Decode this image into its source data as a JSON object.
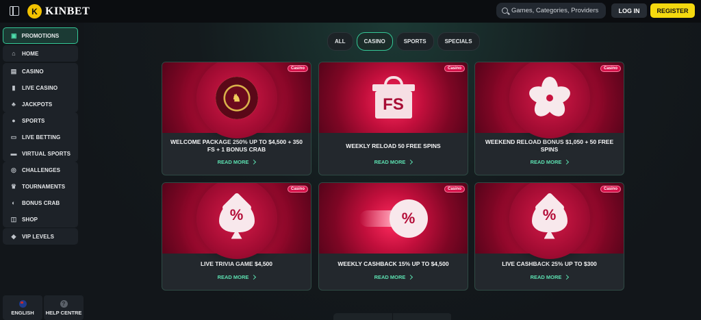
{
  "header": {
    "logo_text": "KINBET",
    "search_placeholder": "Games, Categories, Providers",
    "login_label": "LOG IN",
    "register_label": "REGISTER",
    "register_color": "#f4d90f"
  },
  "sidebar": {
    "active": {
      "label": "PROMOTIONS",
      "icon": "gift-icon"
    },
    "groups": [
      [
        {
          "label": "HOME",
          "icon": "home-icon"
        }
      ],
      [
        {
          "label": "CASINO",
          "icon": "slot-machine-icon"
        },
        {
          "label": "LIVE CASINO",
          "icon": "card-icon"
        },
        {
          "label": "JACKPOTS",
          "icon": "clover-icon"
        }
      ],
      [
        {
          "label": "SPORTS",
          "icon": "ball-icon"
        },
        {
          "label": "LIVE BETTING",
          "icon": "live-icon"
        },
        {
          "label": "VIRTUAL SPORTS",
          "icon": "virtual-icon"
        }
      ],
      [
        {
          "label": "CHALLENGES",
          "icon": "medal-icon"
        },
        {
          "label": "TOURNAMENTS",
          "icon": "trophy-icon"
        },
        {
          "label": "BONUS CRAB",
          "icon": "crab-icon"
        },
        {
          "label": "SHOP",
          "icon": "basket-icon"
        }
      ],
      [
        {
          "label": "VIP LEVELS",
          "icon": "diamond-icon"
        }
      ]
    ],
    "language_label": "ENGLISH",
    "help_label": "HELP CENTRE",
    "accent_color": "#35c998"
  },
  "tabs": [
    {
      "label": "ALL",
      "active": false
    },
    {
      "label": "CASINO",
      "active": true
    },
    {
      "label": "SPORTS",
      "active": false
    },
    {
      "label": "SPECIALS",
      "active": false
    }
  ],
  "cards": [
    {
      "badge": "Casino",
      "title": "WELCOME PACKAGE 250% UP TO $4,500 + 350 FS + 1 BONUS CRAB",
      "cta": "READ MORE",
      "art": "chip-icon"
    },
    {
      "badge": "Casino",
      "title": "WEEKLY RELOAD 50 FREE SPINS",
      "cta": "READ MORE",
      "art": "gift-fs-icon"
    },
    {
      "badge": "Casino",
      "title": "WEEKEND RELOAD BONUS $1,050 + 50 FREE SPINS",
      "cta": "READ MORE",
      "art": "flower-icon"
    },
    {
      "badge": "Casino",
      "title": "LIVE TRIVIA GAME $4,500",
      "cta": "READ MORE",
      "art": "spade-percent-icon"
    },
    {
      "badge": "Casino",
      "title": "WEEKLY CASHBACK 15% UP TO $4,500",
      "cta": "READ MORE",
      "art": "rocket-percent-icon"
    },
    {
      "badge": "Casino",
      "title": "LIVE CASHBACK 25% UP TO $300",
      "cta": "READ MORE",
      "art": "spade-percent-icon"
    }
  ],
  "art_text": {
    "fs": "FS",
    "percent": "%"
  }
}
